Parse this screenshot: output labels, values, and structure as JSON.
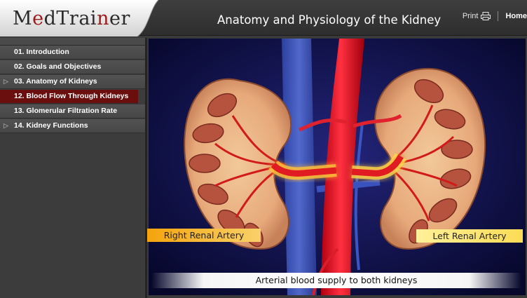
{
  "app": {
    "logo_text_pre": "M",
    "logo_text_mid": "e",
    "logo_text_post": "dTrai",
    "logo_text_n": "n",
    "logo_text_end": "er",
    "course_title": "Anatomy and Physiology of the Kidney",
    "print_label": "Print",
    "home_label": "Home"
  },
  "sidebar": {
    "items": [
      {
        "label": "01. Introduction",
        "active": false,
        "has_arrow": false
      },
      {
        "label": "02. Goals and Objectives",
        "active": false,
        "has_arrow": false
      },
      {
        "label": "03. Anatomy of Kidneys",
        "active": false,
        "has_arrow": true
      },
      {
        "label": "12. Blood Flow Through Kidneys",
        "active": true,
        "has_arrow": false
      },
      {
        "label": "13. Glomerular Filtration Rate",
        "active": false,
        "has_arrow": false
      },
      {
        "label": "14. Kidney Functions",
        "active": false,
        "has_arrow": true
      }
    ]
  },
  "stage": {
    "label_right": "Right Renal Artery",
    "label_left": "Left Renal Artery",
    "caption": "Arterial blood supply to both kidneys"
  },
  "colors": {
    "accent_red": "#9e1b1b",
    "active_item": "#6b0e0e",
    "stage_bg": "#0a0b2e"
  }
}
